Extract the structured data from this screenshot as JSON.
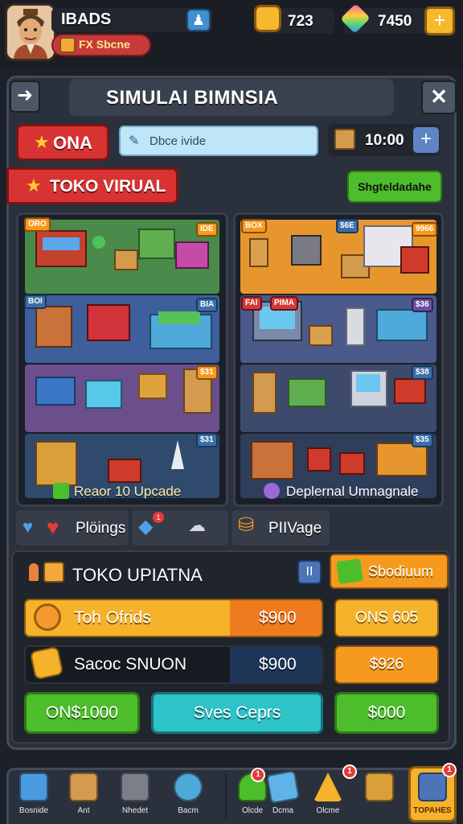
{
  "player": {
    "name": "IBADS",
    "subtitle": "FX Sbcne"
  },
  "currency": {
    "gold": "723",
    "gems": "7450",
    "crates": "10:00"
  },
  "header": {
    "title": "SIMULAI BIMNSIA"
  },
  "tabs": {
    "active_label": "ONA"
  },
  "search": {
    "text": "Dbce ivide"
  },
  "banner": {
    "text": "TOKO VIRUAL",
    "button_label": "Shgteldadahe"
  },
  "shop_left": {
    "caption": "Reaor 10 Upcade",
    "tags": [
      "ORO",
      "IDE",
      "BOI",
      "BIA",
      "$31",
      "$31"
    ]
  },
  "shop_right": {
    "caption": "Deplernal Umnagnale",
    "tags": [
      "BOX",
      "$6E",
      "9966",
      "FAI",
      "PIMA",
      "$36",
      "$38",
      "$35"
    ]
  },
  "reactions": {
    "label_1": "Plöings",
    "label_2": "PIIVage",
    "badge": "1"
  },
  "upgrade": {
    "title": "TOKO UPIATNA",
    "mini_button": "II",
    "orange_button": "Sbodiuum",
    "row1": {
      "label": "Toh Ofrids",
      "cost": "$900",
      "side": "ONS 605"
    },
    "row2": {
      "label": "Sacoc SNUON",
      "cost": "$900",
      "side": "$926"
    },
    "btn_a": "ON$1000",
    "btn_b": "Sves Ceprs",
    "btn_c": "$000"
  },
  "nav": {
    "items": [
      {
        "label": "Bosnide",
        "icon": "house-icon"
      },
      {
        "label": "Ant",
        "icon": "crate-icon"
      },
      {
        "label": "Nhedet",
        "icon": "box-icon"
      },
      {
        "label": "Bacm",
        "icon": "compass-icon"
      },
      {
        "label": "Olcde",
        "icon": "tree-icon"
      },
      {
        "label": "Dcma",
        "icon": "card-icon"
      },
      {
        "label": "Olcme",
        "icon": "pyramid-icon"
      },
      {
        "label": "TOPAHES",
        "icon": "tools-icon"
      }
    ],
    "badges": [
      "1",
      "1",
      "1"
    ]
  },
  "colors": {
    "accent_red": "#d93232",
    "accent_orange": "#f59a1e",
    "accent_green": "#4ebd2b",
    "accent_cyan": "#2ec2c9",
    "panel_bg": "#2b313c"
  }
}
